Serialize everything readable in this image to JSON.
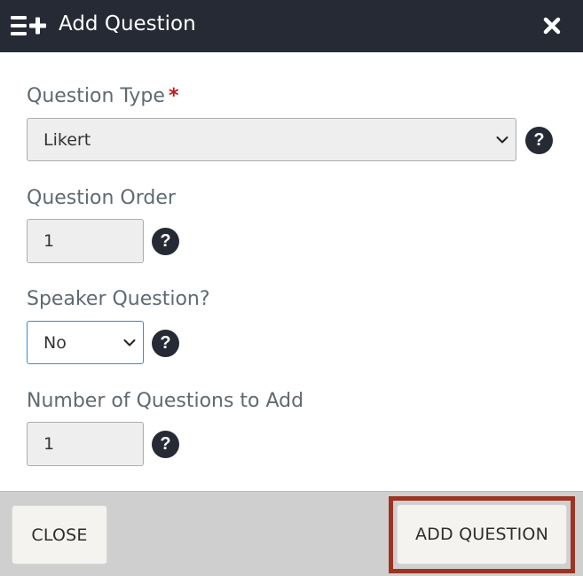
{
  "header": {
    "title": "Add Question",
    "icon": "list-plus-icon",
    "close_icon": "close-icon"
  },
  "form": {
    "question_type": {
      "label": "Question Type",
      "required_mark": "*",
      "value": "Likert"
    },
    "question_order": {
      "label": "Question Order",
      "value": "1"
    },
    "speaker_question": {
      "label": "Speaker Question?",
      "value": "No"
    },
    "num_questions": {
      "label": "Number of Questions to Add",
      "value": "1"
    },
    "help_glyph": "?"
  },
  "footer": {
    "close_label": "CLOSE",
    "add_label": "ADD QUESTION"
  },
  "colors": {
    "header_bg": "#262a35",
    "label": "#5f6a72",
    "required": "#c4181c",
    "focus_border": "#2f8fd8",
    "highlight_border": "#9c3421",
    "footer_bg": "#cfcfcf"
  }
}
